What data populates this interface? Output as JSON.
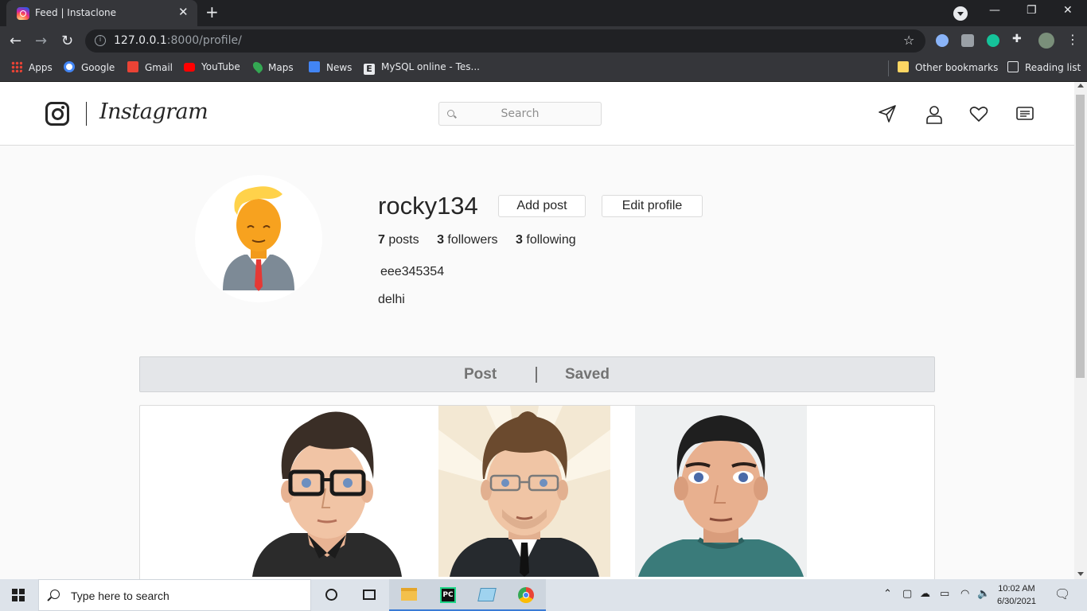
{
  "browser": {
    "tab_title": "Feed | Instaclone",
    "url_host": "127.0.0.1",
    "url_rest": ":8000/profile/",
    "bookmarks": [
      "Apps",
      "Google",
      "Gmail",
      "YouTube",
      "Maps",
      "News",
      "MySQL online - Tes..."
    ],
    "other_bookmarks": "Other bookmarks",
    "reading_list": "Reading list"
  },
  "header": {
    "brand": "Instagram",
    "search_placeholder": "Search"
  },
  "profile": {
    "username": "rocky134",
    "add_post_label": "Add post",
    "edit_profile_label": "Edit profile",
    "posts_count": "7",
    "posts_label": "posts",
    "followers_count": "3",
    "followers_label": "followers",
    "following_count": "3",
    "following_label": "following",
    "full_name": "eee345354",
    "bio": "delhi"
  },
  "tabs": {
    "post_label": "Post",
    "saved_label": "Saved"
  },
  "taskbar": {
    "search_text": "Type here to search",
    "time": "10:02 AM",
    "date": "6/30/2021"
  }
}
